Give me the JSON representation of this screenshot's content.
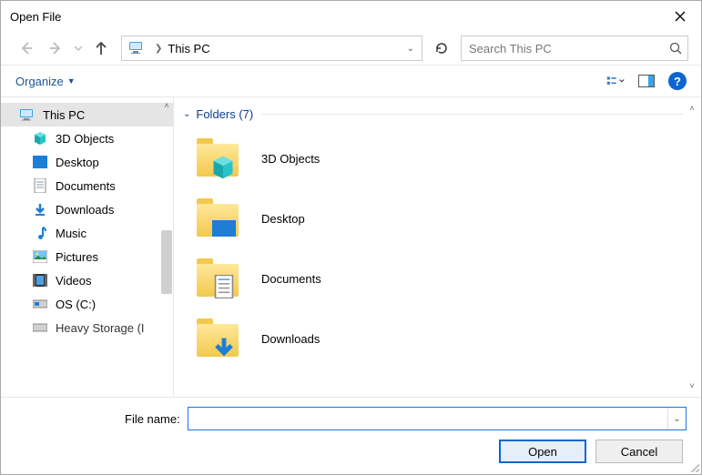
{
  "title": "Open File",
  "address": {
    "location": "This PC"
  },
  "search": {
    "placeholder": "Search This PC"
  },
  "toolbar": {
    "organize_label": "Organize"
  },
  "sidebar": {
    "items": [
      {
        "label": "This PC",
        "icon": "pc-icon",
        "selected": true,
        "root": true
      },
      {
        "label": "3D Objects",
        "icon": "cube-icon",
        "selected": false
      },
      {
        "label": "Desktop",
        "icon": "desktop-icon",
        "selected": false
      },
      {
        "label": "Documents",
        "icon": "document-icon",
        "selected": false
      },
      {
        "label": "Downloads",
        "icon": "download-icon",
        "selected": false
      },
      {
        "label": "Music",
        "icon": "music-icon",
        "selected": false
      },
      {
        "label": "Pictures",
        "icon": "picture-icon",
        "selected": false
      },
      {
        "label": "Videos",
        "icon": "video-icon",
        "selected": false
      },
      {
        "label": "OS (C:)",
        "icon": "drive-icon",
        "selected": false
      },
      {
        "label": "Heavy Storage (I",
        "icon": "drive-icon",
        "selected": false,
        "truncated": true
      }
    ]
  },
  "main": {
    "group_label": "Folders (7)",
    "folders": [
      {
        "label": "3D Objects",
        "overlay": "cube"
      },
      {
        "label": "Desktop",
        "overlay": "desktop"
      },
      {
        "label": "Documents",
        "overlay": "document"
      },
      {
        "label": "Downloads",
        "overlay": "download"
      }
    ]
  },
  "footer": {
    "filename_label": "File name:",
    "filename_value": "",
    "open_label": "Open",
    "cancel_label": "Cancel"
  }
}
